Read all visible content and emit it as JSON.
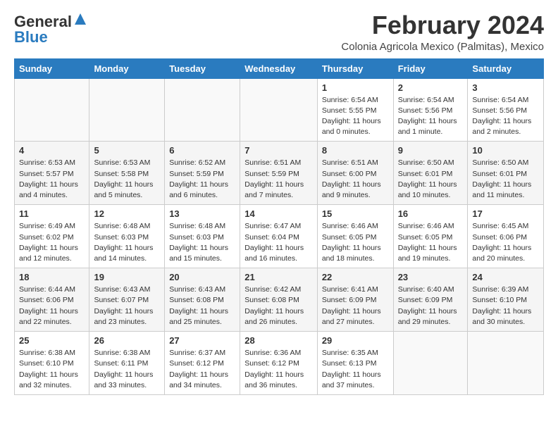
{
  "logo": {
    "general": "General",
    "blue": "Blue"
  },
  "title": "February 2024",
  "subtitle": "Colonia Agricola Mexico (Palmitas), Mexico",
  "days_header": [
    "Sunday",
    "Monday",
    "Tuesday",
    "Wednesday",
    "Thursday",
    "Friday",
    "Saturday"
  ],
  "weeks": [
    [
      {
        "day": "",
        "info": ""
      },
      {
        "day": "",
        "info": ""
      },
      {
        "day": "",
        "info": ""
      },
      {
        "day": "",
        "info": ""
      },
      {
        "day": "1",
        "info": "Sunrise: 6:54 AM\nSunset: 5:55 PM\nDaylight: 11 hours and 0 minutes."
      },
      {
        "day": "2",
        "info": "Sunrise: 6:54 AM\nSunset: 5:56 PM\nDaylight: 11 hours and 1 minute."
      },
      {
        "day": "3",
        "info": "Sunrise: 6:54 AM\nSunset: 5:56 PM\nDaylight: 11 hours and 2 minutes."
      }
    ],
    [
      {
        "day": "4",
        "info": "Sunrise: 6:53 AM\nSunset: 5:57 PM\nDaylight: 11 hours and 4 minutes."
      },
      {
        "day": "5",
        "info": "Sunrise: 6:53 AM\nSunset: 5:58 PM\nDaylight: 11 hours and 5 minutes."
      },
      {
        "day": "6",
        "info": "Sunrise: 6:52 AM\nSunset: 5:59 PM\nDaylight: 11 hours and 6 minutes."
      },
      {
        "day": "7",
        "info": "Sunrise: 6:51 AM\nSunset: 5:59 PM\nDaylight: 11 hours and 7 minutes."
      },
      {
        "day": "8",
        "info": "Sunrise: 6:51 AM\nSunset: 6:00 PM\nDaylight: 11 hours and 9 minutes."
      },
      {
        "day": "9",
        "info": "Sunrise: 6:50 AM\nSunset: 6:01 PM\nDaylight: 11 hours and 10 minutes."
      },
      {
        "day": "10",
        "info": "Sunrise: 6:50 AM\nSunset: 6:01 PM\nDaylight: 11 hours and 11 minutes."
      }
    ],
    [
      {
        "day": "11",
        "info": "Sunrise: 6:49 AM\nSunset: 6:02 PM\nDaylight: 11 hours and 12 minutes."
      },
      {
        "day": "12",
        "info": "Sunrise: 6:48 AM\nSunset: 6:03 PM\nDaylight: 11 hours and 14 minutes."
      },
      {
        "day": "13",
        "info": "Sunrise: 6:48 AM\nSunset: 6:03 PM\nDaylight: 11 hours and 15 minutes."
      },
      {
        "day": "14",
        "info": "Sunrise: 6:47 AM\nSunset: 6:04 PM\nDaylight: 11 hours and 16 minutes."
      },
      {
        "day": "15",
        "info": "Sunrise: 6:46 AM\nSunset: 6:05 PM\nDaylight: 11 hours and 18 minutes."
      },
      {
        "day": "16",
        "info": "Sunrise: 6:46 AM\nSunset: 6:05 PM\nDaylight: 11 hours and 19 minutes."
      },
      {
        "day": "17",
        "info": "Sunrise: 6:45 AM\nSunset: 6:06 PM\nDaylight: 11 hours and 20 minutes."
      }
    ],
    [
      {
        "day": "18",
        "info": "Sunrise: 6:44 AM\nSunset: 6:06 PM\nDaylight: 11 hours and 22 minutes."
      },
      {
        "day": "19",
        "info": "Sunrise: 6:43 AM\nSunset: 6:07 PM\nDaylight: 11 hours and 23 minutes."
      },
      {
        "day": "20",
        "info": "Sunrise: 6:43 AM\nSunset: 6:08 PM\nDaylight: 11 hours and 25 minutes."
      },
      {
        "day": "21",
        "info": "Sunrise: 6:42 AM\nSunset: 6:08 PM\nDaylight: 11 hours and 26 minutes."
      },
      {
        "day": "22",
        "info": "Sunrise: 6:41 AM\nSunset: 6:09 PM\nDaylight: 11 hours and 27 minutes."
      },
      {
        "day": "23",
        "info": "Sunrise: 6:40 AM\nSunset: 6:09 PM\nDaylight: 11 hours and 29 minutes."
      },
      {
        "day": "24",
        "info": "Sunrise: 6:39 AM\nSunset: 6:10 PM\nDaylight: 11 hours and 30 minutes."
      }
    ],
    [
      {
        "day": "25",
        "info": "Sunrise: 6:38 AM\nSunset: 6:10 PM\nDaylight: 11 hours and 32 minutes."
      },
      {
        "day": "26",
        "info": "Sunrise: 6:38 AM\nSunset: 6:11 PM\nDaylight: 11 hours and 33 minutes."
      },
      {
        "day": "27",
        "info": "Sunrise: 6:37 AM\nSunset: 6:12 PM\nDaylight: 11 hours and 34 minutes."
      },
      {
        "day": "28",
        "info": "Sunrise: 6:36 AM\nSunset: 6:12 PM\nDaylight: 11 hours and 36 minutes."
      },
      {
        "day": "29",
        "info": "Sunrise: 6:35 AM\nSunset: 6:13 PM\nDaylight: 11 hours and 37 minutes."
      },
      {
        "day": "",
        "info": ""
      },
      {
        "day": "",
        "info": ""
      }
    ]
  ]
}
